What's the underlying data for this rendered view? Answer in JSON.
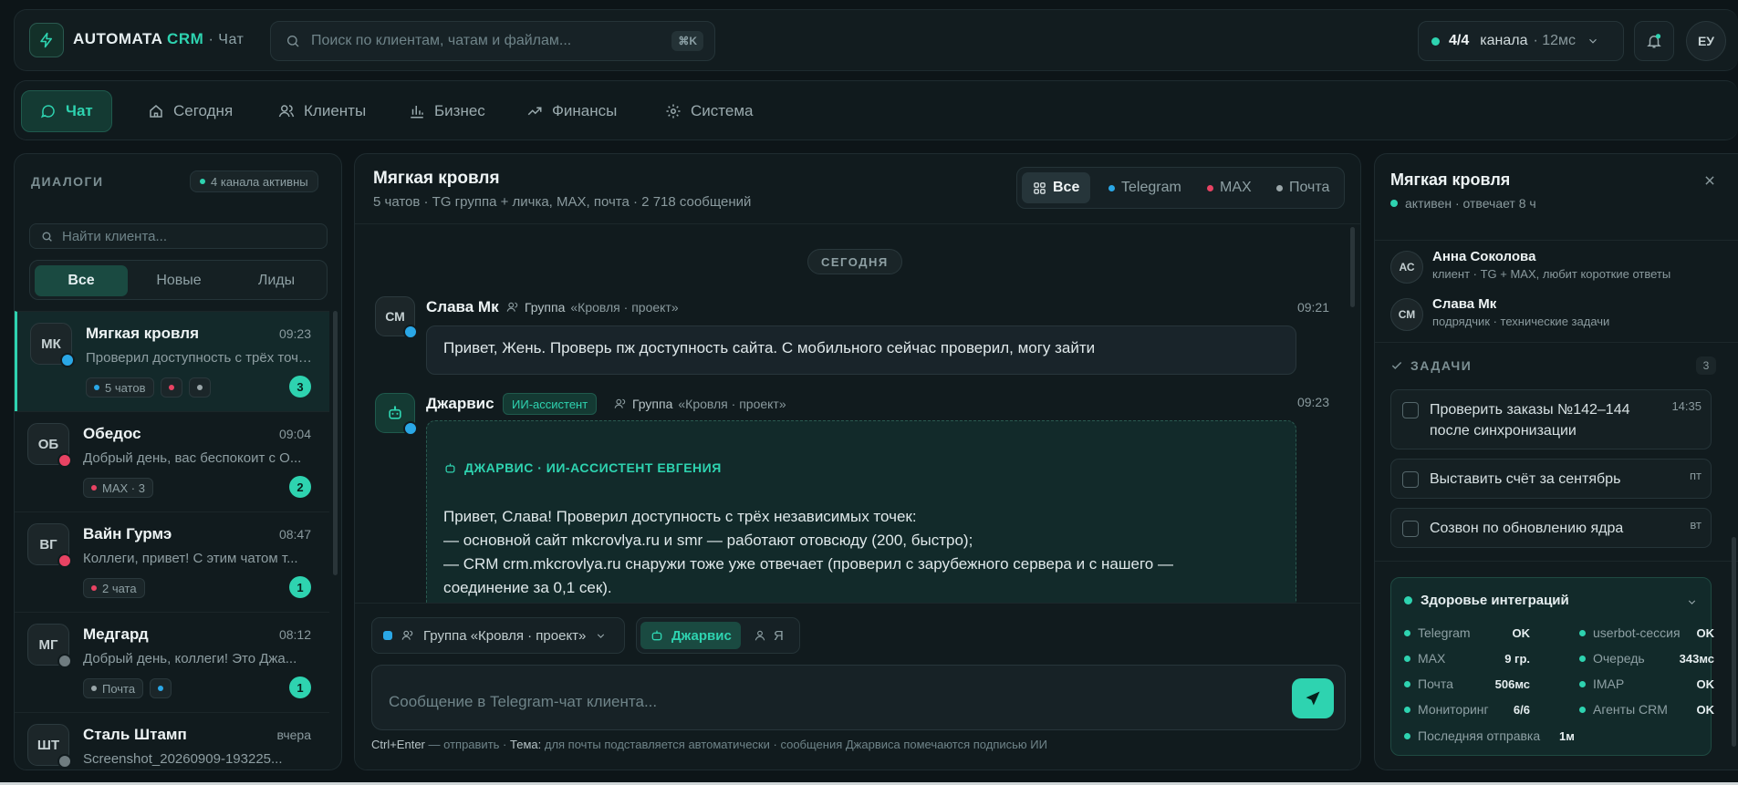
{
  "header": {
    "brand": "AUTOMATA",
    "brand_accent": "CRM",
    "section": "· Чат",
    "search_placeholder": "Поиск по клиентам, чатам и файлам...",
    "search_shortcut": "⌘K",
    "channels_count": "4/4",
    "channels_label": "канала",
    "latency": "· 12мс",
    "user_initials": "ЕУ"
  },
  "nav": {
    "items": [
      {
        "label": "Чат",
        "icon": "chat-bubble-icon",
        "active": true
      },
      {
        "label": "Сегодня",
        "icon": "home-icon"
      },
      {
        "label": "Клиенты",
        "icon": "users-icon"
      },
      {
        "label": "Бизнес",
        "icon": "bar-chart-icon"
      },
      {
        "label": "Финансы",
        "icon": "trend-up-icon"
      },
      {
        "label": "Система",
        "icon": "gear-icon"
      }
    ]
  },
  "dialogs": {
    "title": "ДИАЛОГИ",
    "channels_active": "4 канала активны",
    "search_placeholder": "Найти клиента...",
    "filters": [
      "Все",
      "Новые",
      "Лиды"
    ],
    "items": [
      {
        "initials": "МК",
        "name": "Мягкая кровля",
        "time": "09:23",
        "preview": "Проверил доступность с трёх точек...",
        "tags": [
          "5 чатов",
          "",
          ""
        ],
        "count": "3",
        "channel": "telegram"
      },
      {
        "initials": "ОБ",
        "name": "Обедос",
        "time": "09:04",
        "preview": "Добрый день, вас беспокоит с О...",
        "tags": [
          "MAX · 3"
        ],
        "count": "2",
        "channel": "max"
      },
      {
        "initials": "ВГ",
        "name": "Вайн Гурмэ",
        "time": "08:47",
        "preview": "Коллеги, привет! С этим чатом т...",
        "tags": [
          "2 чата"
        ],
        "count": "1",
        "channel": "max"
      },
      {
        "initials": "МГ",
        "name": "Медгард",
        "time": "08:12",
        "preview": "Добрый день, коллеги! Это Джа...",
        "tags": [
          "Почта",
          ""
        ],
        "count": "1",
        "channel": "mail"
      },
      {
        "initials": "ШТ",
        "name": "Сталь Штамп",
        "time": "вчера",
        "preview": "Screenshot_20260909-193225...",
        "tags": [],
        "count": "",
        "channel": "mail"
      }
    ]
  },
  "chat": {
    "title": "Мягкая кровля",
    "subtitle": "5 чатов · TG группа + личка, MAX, почта · 2 718 сообщений",
    "filters": [
      "Все",
      "Telegram",
      "MAX",
      "Почта"
    ],
    "day_separator": "СЕГОДНЯ",
    "messages": [
      {
        "initials": "СМ",
        "author": "Слава Мк",
        "group_label": "Группа",
        "group_name": "«Кровля · проект»",
        "time": "09:21",
        "text": "Привет, Жень. Проверь пж доступность сайта. С мобильного сейчас проверил, могу зайти"
      },
      {
        "author": "Джарвис",
        "badge": "ИИ-ассистент",
        "group_label": "Группа",
        "group_name": "«Кровля · проект»",
        "time": "09:23",
        "header": "ДЖАРВИС · ИИ-АССИСТЕНТ ЕВГЕНИЯ",
        "lines": [
          "Привет, Слава! Проверил доступность с трёх независимых точек:",
          "— основной сайт mkcrovlya.ru и smr — работают отовсюду (200, быстро);",
          "— CRM crm.mkcrovlya.ru снаружи тоже уже отвечает (проверил с зарубежного сервера и с нашего —",
          "соединение за 0,1 сек)."
        ]
      }
    ],
    "composer": {
      "group_select": "Группа «Кровля · проект»",
      "sender_options": [
        "Джарвис",
        "Я"
      ],
      "placeholder": "Сообщение в Telegram-чат клиента...",
      "hint_key": "Ctrl+Enter",
      "hint_send": "— отправить ·",
      "hint_theme_label": "Тема:",
      "hint_theme": "для почты подставляется автоматически · сообщения Джарвиса помечаются подписью ИИ"
    }
  },
  "client": {
    "title": "Мягкая кровля",
    "status": "активен · отвечает 8 ч",
    "contacts": [
      {
        "initials": "АС",
        "name": "Анна Соколова",
        "desc": "клиент · TG + MAX, любит короткие ответы"
      },
      {
        "initials": "СМ",
        "name": "Слава Мк",
        "desc": "подрядчик · технические задачи"
      }
    ],
    "tasks_title": "ЗАДАЧИ",
    "tasks_count": "3",
    "tasks": [
      {
        "text": "Проверить заказы №142–144 после синхронизации",
        "when": "14:35"
      },
      {
        "text": "Выставить счёт за сентябрь",
        "when": "пт"
      },
      {
        "text": "Созвон по обновлению ядра",
        "when": "вт"
      }
    ],
    "health": {
      "title": "Здоровье интеграций",
      "left": [
        {
          "label": "Telegram",
          "value": "OK"
        },
        {
          "label": "MAX",
          "value": "9 гр."
        },
        {
          "label": "Почта",
          "value": "506мс"
        },
        {
          "label": "Мониторинг",
          "value": "6/6"
        },
        {
          "label": "Последняя отправка",
          "value": "1м"
        }
      ],
      "right": [
        {
          "label": "userbot-сессия",
          "value": "OK"
        },
        {
          "label": "Очередь",
          "value": "343мс"
        },
        {
          "label": "IMAP",
          "value": "OK"
        },
        {
          "label": "Агенты CRM",
          "value": "OK"
        }
      ]
    }
  },
  "colors": {
    "accent": "#2ed3b0",
    "telegram": "#2aa7e6",
    "max": "#e84363",
    "mail": "#9aa6a9",
    "background": "#0d1518"
  }
}
